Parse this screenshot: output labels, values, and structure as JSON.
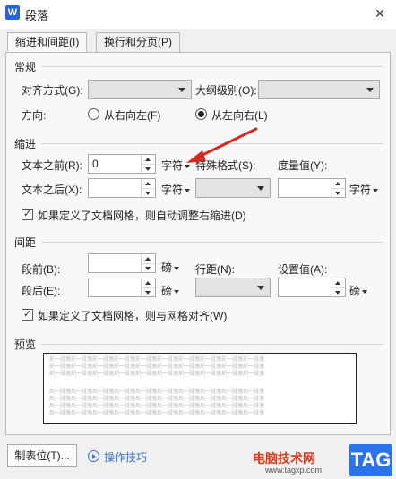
{
  "window": {
    "app_icon_letter": "W",
    "title": "段落",
    "close": "×"
  },
  "tabs": [
    {
      "label": "缩进和间距(I)"
    },
    {
      "label": "换行和分页(P)"
    }
  ],
  "general": {
    "section_label": "常规",
    "alignment_label": "对齐方式(G):",
    "alignment_value": "",
    "outline_label": "大纲级别(O):",
    "outline_value": "",
    "direction_label": "方向:",
    "rtl_label": "从右向左(F)",
    "ltr_label": "从左向右(L)",
    "selected_direction": "ltr"
  },
  "indent": {
    "section_label": "缩进",
    "before_label": "文本之前(R):",
    "before_value": "0",
    "before_unit": "字符",
    "special_label": "特殊格式(S):",
    "measure_label": "度量值(Y):",
    "after_label": "文本之后(X):",
    "after_value": "",
    "after_unit": "字符",
    "special_value": "",
    "measure_value": "",
    "measure_unit": "字符",
    "grid_check_label": "如果定义了文档网格，则自动调整右缩进(D)",
    "grid_checked": true
  },
  "spacing": {
    "section_label": "间距",
    "before_label": "段前(B):",
    "before_value": "",
    "before_unit": "磅",
    "line_label": "行距(N):",
    "setvalue_label": "设置值(A):",
    "after_label": "段后(E):",
    "after_value": "",
    "after_unit": "磅",
    "line_value": "",
    "setvalue_value": "",
    "setvalue_unit": "磅",
    "grid_check_label": "如果定义了文档网格，则与网格对齐(W)",
    "grid_checked": true
  },
  "preview": {
    "section_label": "预览",
    "prev_line": "前一段落前一段落前一段落前一段落前一段落前一段落前一段落前一段落前一段落前一段落",
    "next_line": "后一段落后一段落后一段落后一段落后一段落后一段落后一段落后一段落后一段落后一段落"
  },
  "footer": {
    "tabs_button": "制表位(T)...",
    "tips_label": "操作技巧"
  },
  "watermark": {
    "badge": "TAG",
    "site_name": "电脑技术网",
    "url": "www.tagxp.com"
  },
  "annotation": {
    "arrow_color": "#d42a1f"
  }
}
